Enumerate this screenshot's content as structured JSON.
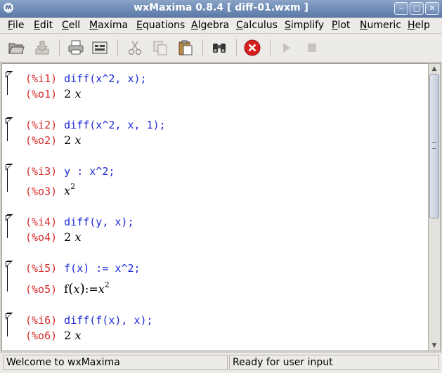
{
  "window": {
    "title": "wxMaxima 0.8.4  [ diff-01.wxm ]",
    "app_icon": "wxmaxima-icon",
    "controls": [
      "minimize",
      "maximize",
      "close"
    ]
  },
  "menu": [
    "File",
    "Edit",
    "Cell",
    "Maxima",
    "Equations",
    "Algebra",
    "Calculus",
    "Simplify",
    "Plot",
    "Numeric",
    "Help"
  ],
  "toolbar": {
    "buttons": [
      "open-folder-icon",
      "save-icon",
      "print-icon",
      "config-icon",
      "cut-icon",
      "copy-icon",
      "paste-icon",
      "find-icon",
      "interrupt-icon",
      "continue-icon",
      "stop-icon"
    ],
    "interrupt_color": "#d81f1f"
  },
  "cells": [
    {
      "in_label": "(%i1)",
      "input": "diff(x^2, x);",
      "out_label": "(%o1)",
      "output": {
        "coef": "2",
        "var": "x",
        "exp": ""
      }
    },
    {
      "in_label": "(%i2)",
      "input": "diff(x^2, x, 1);",
      "out_label": "(%o2)",
      "output": {
        "coef": "2",
        "var": "x",
        "exp": ""
      }
    },
    {
      "in_label": "(%i3)",
      "input": "y : x^2;",
      "out_label": "(%o3)",
      "output": {
        "coef": "",
        "var": "x",
        "exp": "2"
      }
    },
    {
      "in_label": "(%i4)",
      "input": "diff(y, x);",
      "out_label": "(%o4)",
      "output": {
        "coef": "2",
        "var": "x",
        "exp": ""
      }
    },
    {
      "in_label": "(%i5)",
      "input": "f(x) := x^2;",
      "out_label": "(%o5)",
      "output": {
        "fn": "f",
        "arg": "x",
        "op": ":=",
        "var": "x",
        "exp": "2"
      }
    },
    {
      "in_label": "(%i6)",
      "input": "diff(f(x), x);",
      "out_label": "(%o6)",
      "output": {
        "coef": "2",
        "var": "x",
        "exp": ""
      }
    }
  ],
  "status": {
    "left": "Welcome to wxMaxima",
    "right": "Ready for user input"
  },
  "colors": {
    "input_label": "#d62b2b",
    "input_text": "#1e2bd6",
    "title_bar": "#6f8cb8"
  }
}
